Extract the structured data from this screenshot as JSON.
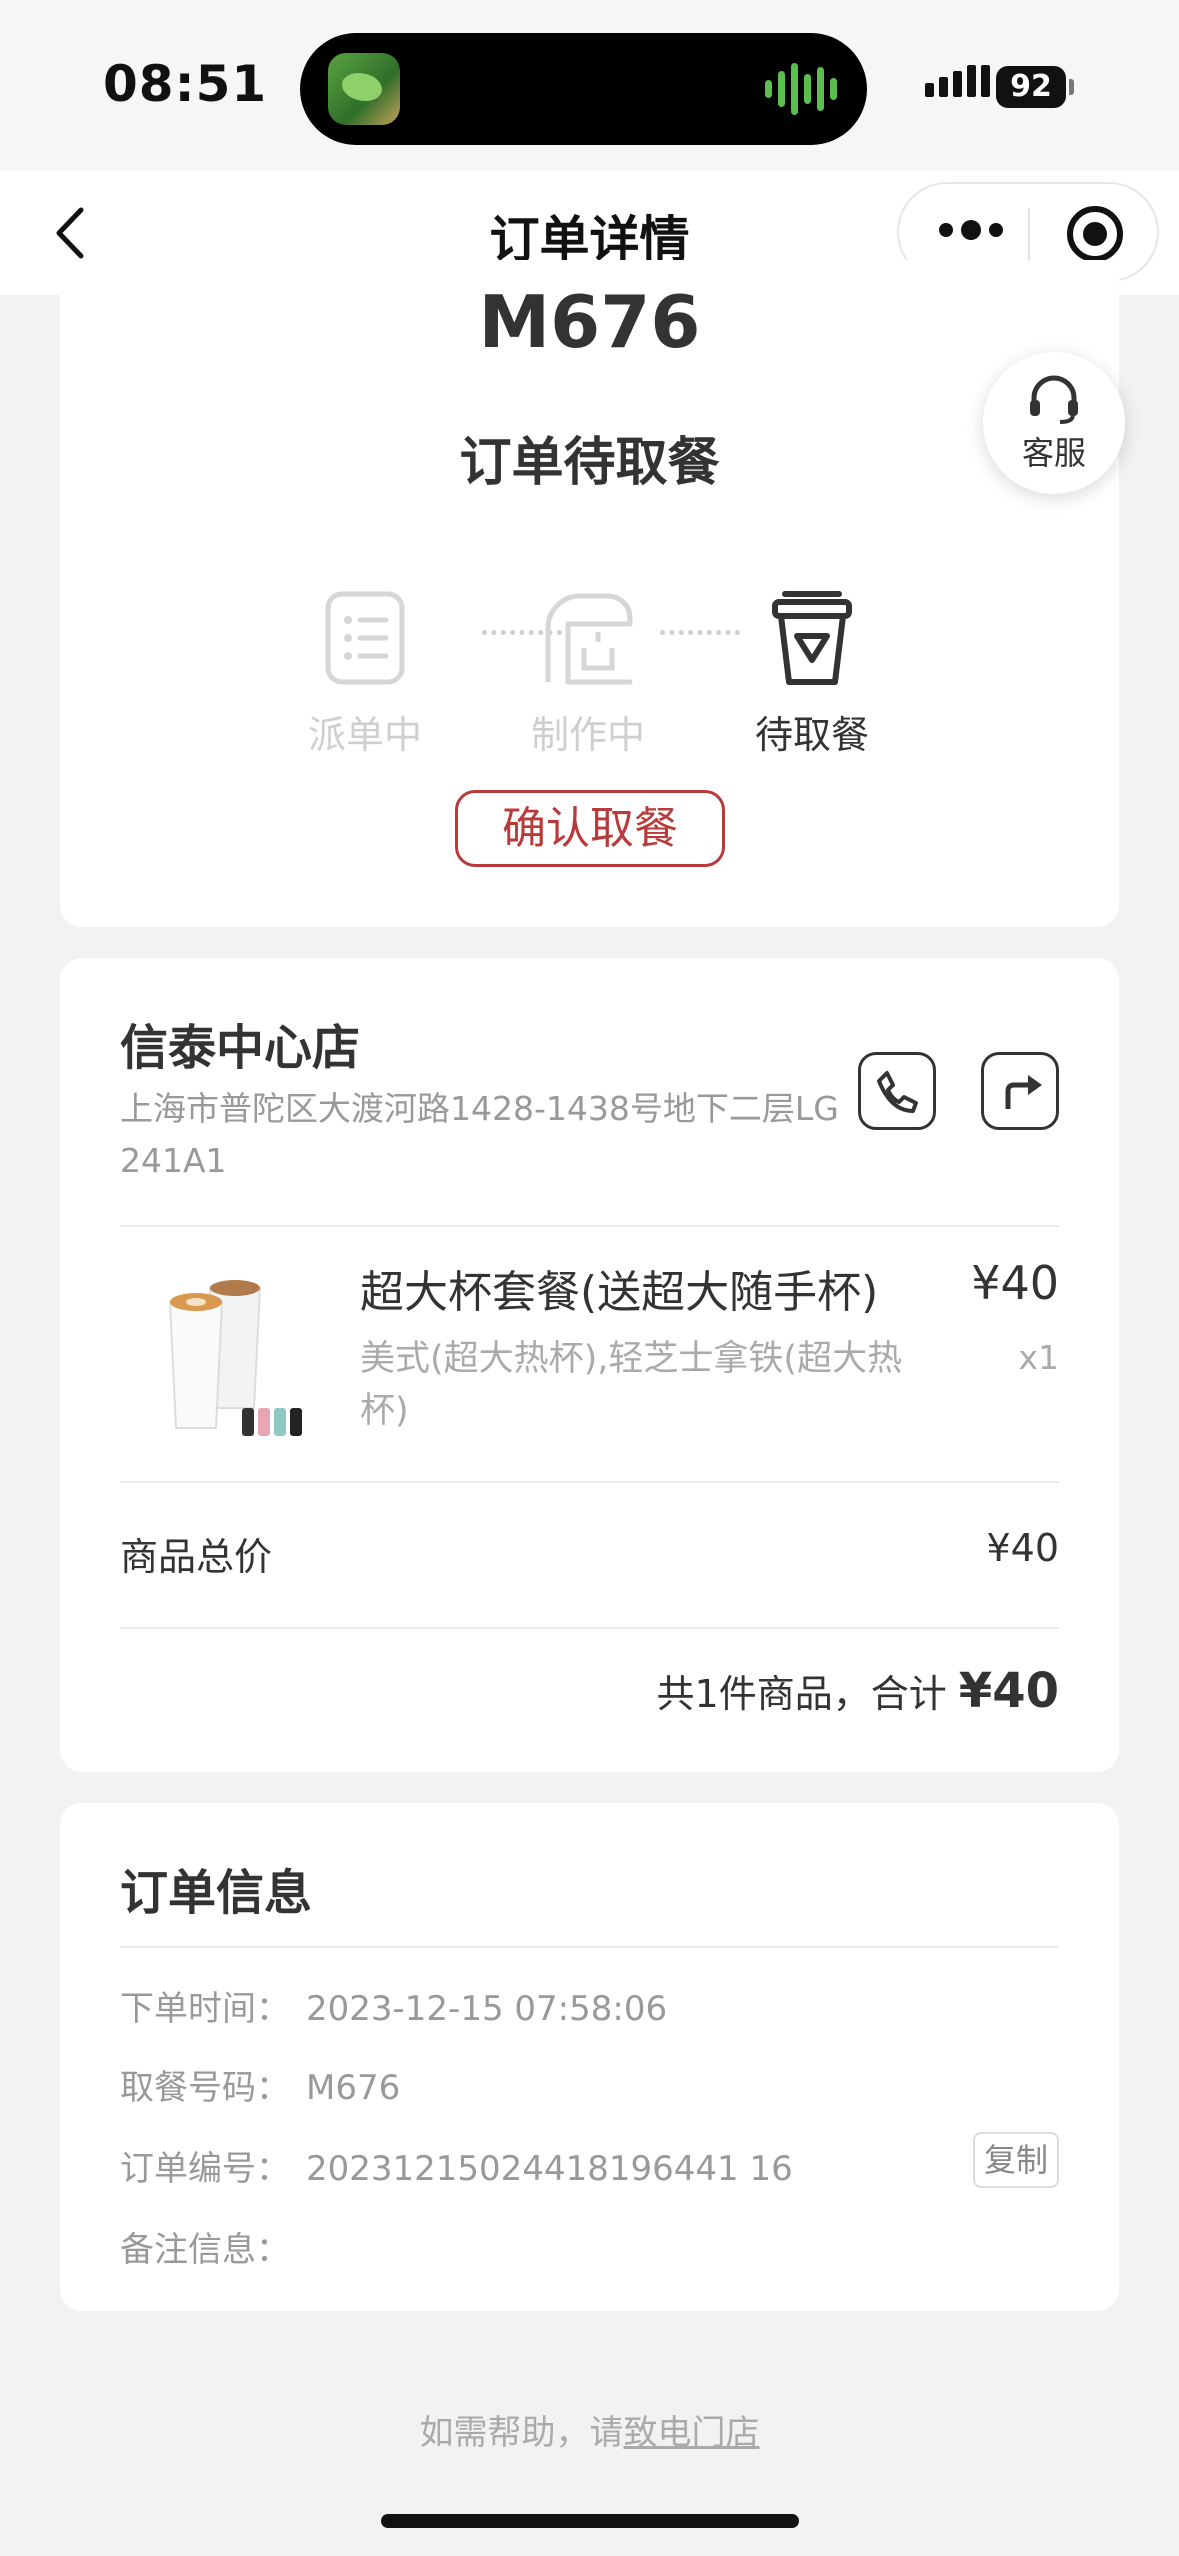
{
  "status_bar": {
    "time": "08:51",
    "battery": "92"
  },
  "nav": {
    "title": "订单详情"
  },
  "order": {
    "pickup_code": "M676",
    "status": "订单待取餐",
    "steps": [
      "派单中",
      "制作中",
      "待取餐"
    ],
    "active_step": 2,
    "confirm_label": "确认取餐"
  },
  "service": {
    "label": "客服"
  },
  "store": {
    "name": "信泰中心店",
    "address": "上海市普陀区大渡河路1428-1438号地下二层LG 241A1"
  },
  "product": {
    "name": "超大杯套餐(送超大随手杯)",
    "desc": "美式(超大热杯),轻芝士拿铁(超大热杯)",
    "price": "¥40",
    "qty": "x1"
  },
  "summary": {
    "subtotal_label": "商品总价",
    "subtotal_value": "¥40",
    "total_prefix": "共1件商品，合计",
    "total_value": "¥40"
  },
  "order_info": {
    "title": "订单信息",
    "rows": [
      {
        "key": "下单时间：",
        "value": "2023-12-15 07:58:06"
      },
      {
        "key": "取餐号码：",
        "value": "M676"
      },
      {
        "key": "订单编号：",
        "value": "20231215024418196441 16"
      },
      {
        "key": "备注信息：",
        "value": ""
      }
    ],
    "copy_label": "复制"
  },
  "footer": {
    "help_text": "如需帮助，请",
    "help_link": "致电门店"
  },
  "colors": {
    "accent_red": "#b83a3a",
    "bg": "#f2f2f2"
  }
}
